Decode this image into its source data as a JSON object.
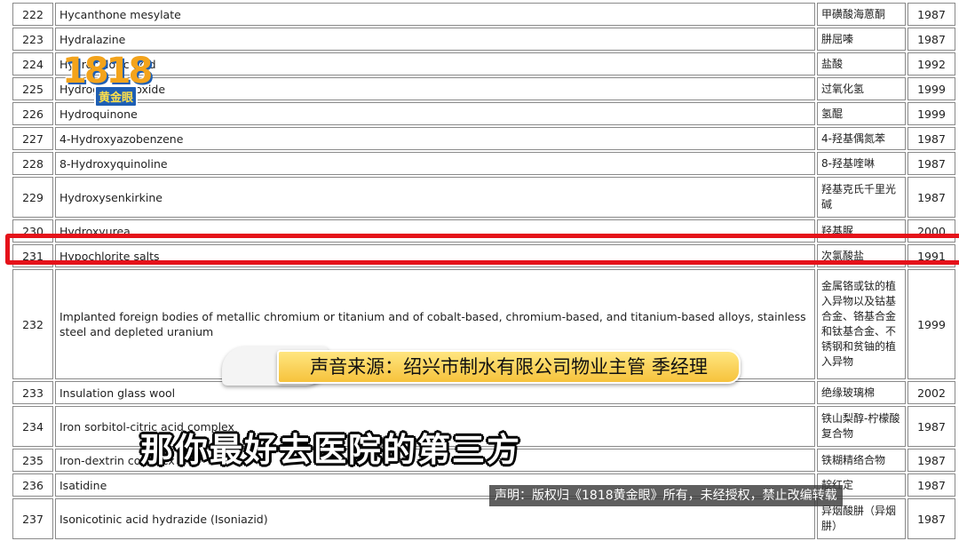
{
  "rows": [
    {
      "num": "222",
      "name": "Hycanthone mesylate",
      "zh": "甲磺酸海蒽酮",
      "year": "1987"
    },
    {
      "num": "223",
      "name": "Hydralazine",
      "zh": "肼屈嗪",
      "year": "1987"
    },
    {
      "num": "224",
      "name": "Hydrochloric acid",
      "zh": "盐酸",
      "year": "1992"
    },
    {
      "num": "225",
      "name": "Hydrogen peroxide",
      "zh": "过氧化氢",
      "year": "1999"
    },
    {
      "num": "226",
      "name": "Hydroquinone",
      "zh": "氢醌",
      "year": "1999"
    },
    {
      "num": "227",
      "name": "4-Hydroxyazobenzene",
      "zh": "4-羟基偶氮苯",
      "year": "1987"
    },
    {
      "num": "228",
      "name": "8-Hydroxyquinoline",
      "zh": "8-羟基喹啉",
      "year": "1987"
    },
    {
      "num": "229",
      "name": "Hydroxysenkirkine",
      "zh": "羟基克氏千里光碱",
      "year": "1987"
    },
    {
      "num": "230",
      "name": "Hydroxyurea",
      "zh": "羟基脲",
      "year": "2000"
    },
    {
      "num": "231",
      "name": "Hypochlorite salts",
      "zh": "次氯酸盐",
      "year": "1991"
    },
    {
      "num": "232",
      "name": "Implanted foreign bodies of metallic chromium or titanium and of cobalt-based, chromium-based, and titanium-based alloys, stainless steel and depleted uranium",
      "zh": "金属铬或钛的植入异物以及钴基合金、铬基合金和钛基合金、不锈钢和贫铀的植入异物",
      "year": "1999"
    },
    {
      "num": "233",
      "name": "Insulation glass wool",
      "zh": "绝缘玻璃棉",
      "year": "2002"
    },
    {
      "num": "234",
      "name": "Iron sorbitol-citric acid complex",
      "zh": "铁山梨醇-柠檬酸复合物",
      "year": "1987"
    },
    {
      "num": "235",
      "name": "Iron-dextrin complex",
      "zh": "铁糊精络合物",
      "year": "1987"
    },
    {
      "num": "236",
      "name": "Isatidine",
      "zh": "靛红定",
      "year": "1987"
    },
    {
      "num": "237",
      "name": "Isonicotinic acid hydrazide (Isoniazid)",
      "zh": "异烟酸肼（异烟肼）",
      "year": "1987"
    }
  ],
  "logo": {
    "number": "1818",
    "name": "黄金眼"
  },
  "source_banner": "声音来源：绍兴市制水有限公司物业主管 季经理",
  "subtitle": "那你最好去医院的第三方",
  "copyright": "声明：版权归《1818黄金眼》所有，未经授权，禁止改编转载",
  "colors": {
    "highlight": "#e5121a",
    "banner": "#f6c23c",
    "logo_blue": "#1e5fb4",
    "logo_orange": "#f3a31b"
  }
}
